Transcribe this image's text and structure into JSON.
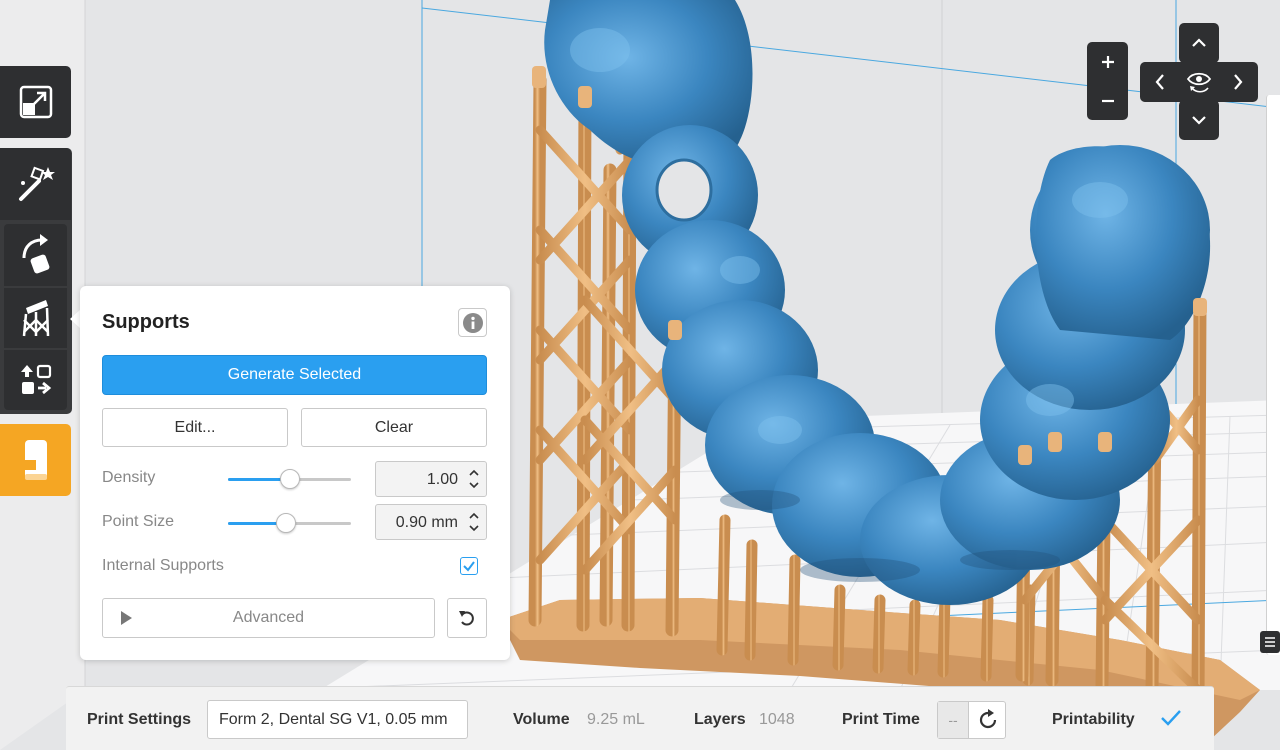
{
  "toolbar": {
    "tools": [
      {
        "name": "fit-view",
        "icon": "expand-icon"
      },
      {
        "name": "one-click-print",
        "icon": "magic-wand-icon"
      },
      {
        "name": "orientation",
        "icon": "rotate-icon"
      },
      {
        "name": "supports",
        "icon": "supports-icon"
      },
      {
        "name": "layout",
        "icon": "layout-icon"
      },
      {
        "name": "print",
        "icon": "printer-icon"
      }
    ],
    "active_color": "#f5a623"
  },
  "supports_panel": {
    "title": "Supports",
    "generate_label": "Generate Selected",
    "edit_label": "Edit...",
    "clear_label": "Clear",
    "density_label": "Density",
    "density_value": "1.00",
    "density_fraction": 0.5,
    "point_size_label": "Point Size",
    "point_size_value": "0.90 mm",
    "point_size_fraction": 0.47,
    "internal_supports_label": "Internal Supports",
    "internal_supports_checked": true,
    "advanced_label": "Advanced"
  },
  "camera": {
    "zoom_in": "+",
    "zoom_out": "−"
  },
  "status_bar": {
    "print_settings_label": "Print Settings",
    "print_settings_value": "Form 2, Dental SG V1, 0.05 mm",
    "volume_label": "Volume",
    "volume_value": "9.25 mL",
    "layers_label": "Layers",
    "layers_value": "1048",
    "print_time_label": "Print Time",
    "print_time_value": "--",
    "printability_label": "Printability"
  },
  "colors": {
    "model": "#3d88c2",
    "supports": "#dfa568",
    "accent": "#2a9ff0",
    "toolbar": "#2e2f31"
  }
}
